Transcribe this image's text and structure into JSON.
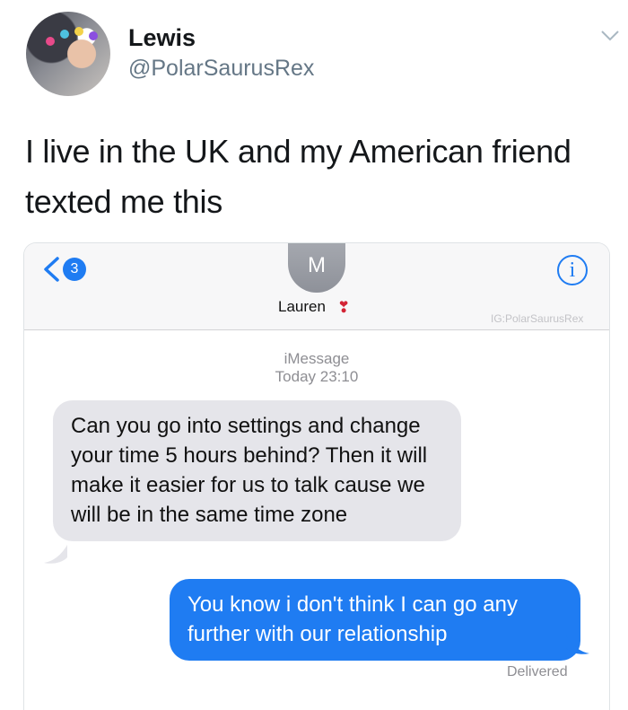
{
  "tweet": {
    "author_name": "Lewis",
    "author_handle": "@PolarSaurusRex",
    "text": "I live in the UK and my American friend texted me this"
  },
  "imessage": {
    "unread_count": "3",
    "contact_initial": "M",
    "contact_name": "Lauren",
    "contact_emoji": "❣",
    "info_label": "i",
    "watermark": "IG:PolarSaurusRex",
    "service": "iMessage",
    "timestamp": "Today 23:10",
    "messages": [
      {
        "direction": "incoming",
        "text": "Can you go into settings and change your time 5 hours behind? Then it will make it easier for us to talk cause we will be in the same time zone"
      },
      {
        "direction": "outgoing",
        "text": "You know i don't think I can go any further with our relationship"
      }
    ],
    "status": "Delivered"
  },
  "colors": {
    "imessage_blue": "#1f7cf2",
    "incoming_bubble": "#e5e5ea",
    "handle_gray": "#657786"
  },
  "icons": [
    "chevron-down-icon",
    "back-chevron-icon",
    "info-icon",
    "heart-exclamation-icon"
  ]
}
